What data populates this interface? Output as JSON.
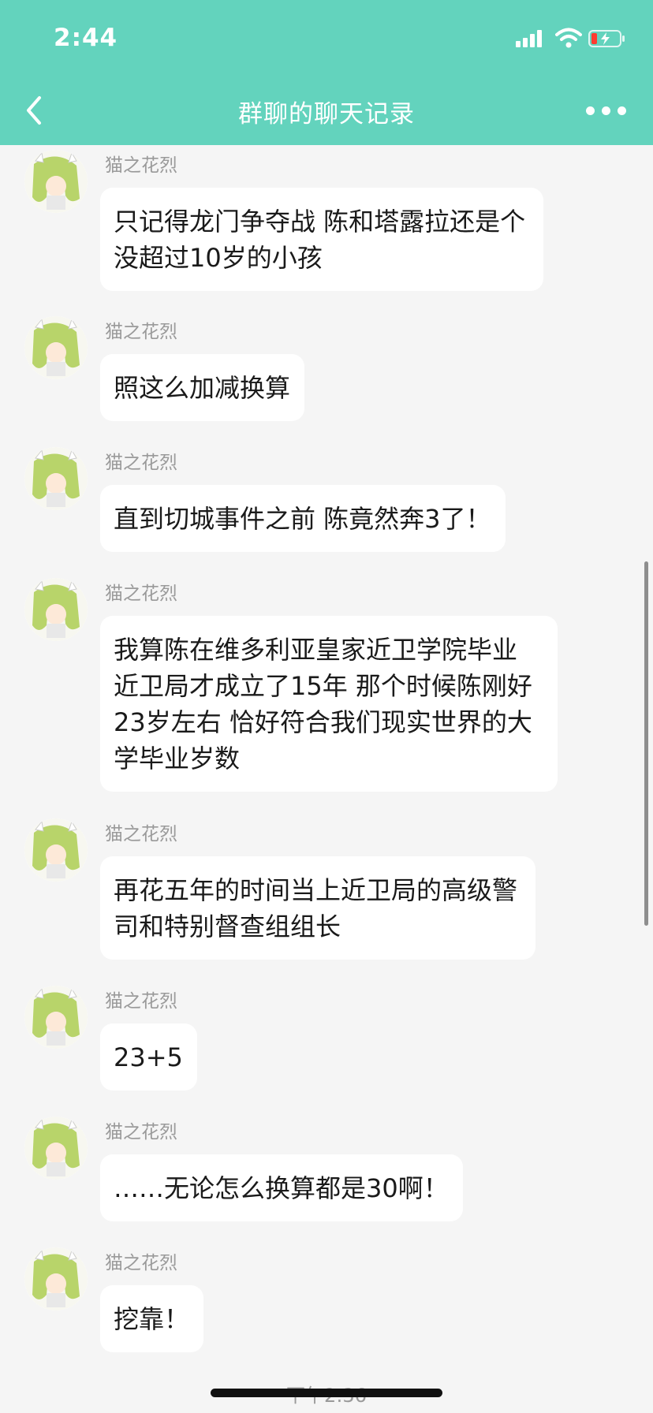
{
  "status_bar": {
    "time": "2:44"
  },
  "nav": {
    "title": "群聊的聊天记录"
  },
  "messages": [
    {
      "sender": "猫之花烈",
      "text": "只记得龙门争夺战 陈和塔露拉还是个没超过10岁的小孩"
    },
    {
      "sender": "猫之花烈",
      "text": "照这么加减换算"
    },
    {
      "sender": "猫之花烈",
      "text": "直到切城事件之前 陈竟然奔3了！"
    },
    {
      "sender": "猫之花烈",
      "text": "我算陈在维多利亚皇家近卫学院毕业 近卫局才成立了15年 那个时候陈刚好23岁左右 恰好符合我们现实世界的大学毕业岁数"
    },
    {
      "sender": "猫之花烈",
      "text": "再花五年的时间当上近卫局的高级警司和特别督查组组长"
    },
    {
      "sender": "猫之花烈",
      "text": "23+5"
    },
    {
      "sender": "猫之花烈",
      "text": "……无论怎么换算都是30啊！"
    },
    {
      "sender": "猫之花烈",
      "text": "挖靠！"
    }
  ],
  "divider": {
    "time": "下午2:36"
  },
  "colors": {
    "header": "#63d3bd",
    "background": "#f5f5f5",
    "bubble": "#ffffff"
  }
}
